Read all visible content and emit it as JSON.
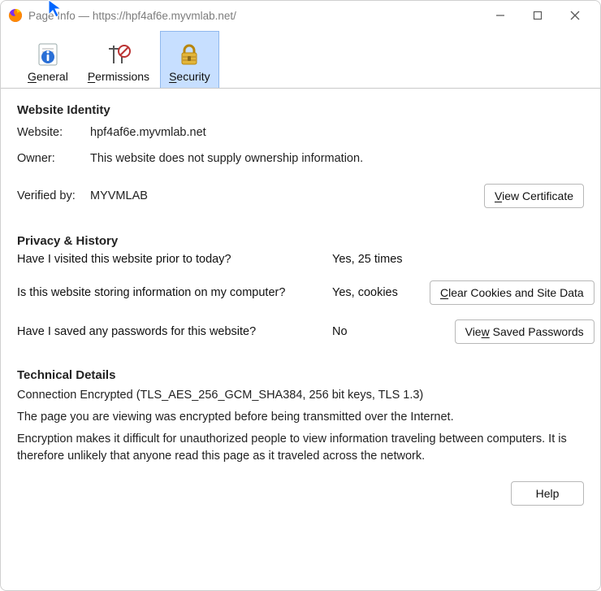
{
  "titlebar": {
    "title_prefix": "Page Info — ",
    "url": "https://hpf4af6e.myvmlab.net/"
  },
  "toolbar": {
    "general": {
      "label": "General",
      "ul": "G"
    },
    "permissions": {
      "label": "Permissions",
      "ul": "P"
    },
    "security": {
      "label": "Security",
      "ul": "S"
    }
  },
  "identity": {
    "heading": "Website Identity",
    "website_label": "Website:",
    "website_value": "hpf4af6e.myvmlab.net",
    "owner_label": "Owner:",
    "owner_value": "This website does not supply ownership information.",
    "verified_label": "Verified by:",
    "verified_value": "MYVMLAB",
    "view_cert_pre": "",
    "view_cert_u": "V",
    "view_cert_post": "iew Certificate"
  },
  "privacy": {
    "heading": "Privacy & History",
    "q_visited": "Have I visited this website prior to today?",
    "a_visited": "Yes, 25 times",
    "q_storing": "Is this website storing information on my computer?",
    "a_storing": "Yes, cookies",
    "clear_u": "C",
    "clear_post": "lear Cookies and Site Data",
    "q_passwords": "Have I saved any passwords for this website?",
    "a_passwords": "No",
    "viewpw_pre": "Vie",
    "viewpw_u": "w",
    "viewpw_post": " Saved Passwords"
  },
  "technical": {
    "heading": "Technical Details",
    "line1": "Connection Encrypted (TLS_AES_256_GCM_SHA384, 256 bit keys, TLS 1.3)",
    "line2": "The page you are viewing was encrypted before being transmitted over the Internet.",
    "line3": "Encryption makes it difficult for unauthorized people to view information traveling between computers. It is therefore unlikely that anyone read this page as it traveled across the network."
  },
  "help": {
    "label": "Help"
  }
}
